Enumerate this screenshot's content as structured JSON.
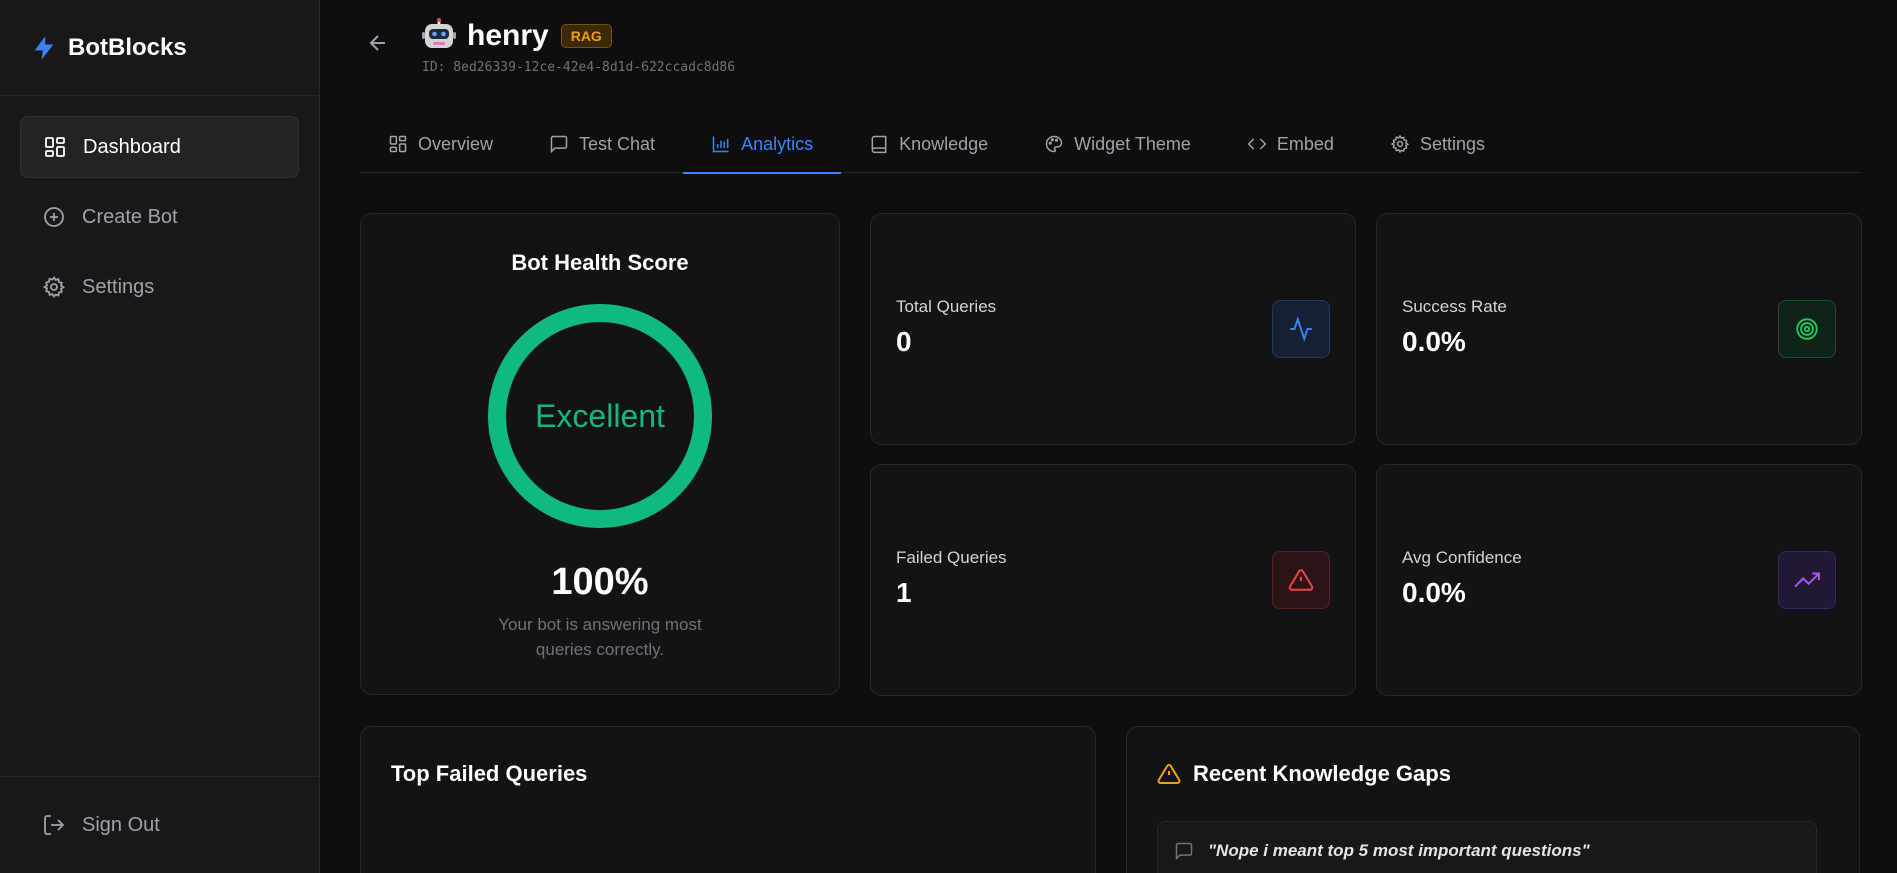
{
  "app": {
    "name": "BotBlocks",
    "accent": "#3b82f6"
  },
  "sidebar": {
    "items": [
      {
        "label": "Dashboard",
        "icon": "dashboard-icon",
        "active": true
      },
      {
        "label": "Create Bot",
        "icon": "plus-circle-icon"
      },
      {
        "label": "Settings",
        "icon": "gear-icon"
      }
    ],
    "sign_out": "Sign Out"
  },
  "bot": {
    "name": "henry",
    "badge": "RAG",
    "id_text": "ID: 8ed26339-12ce-42e4-8d1d-622ccadc8d86"
  },
  "tabs": [
    {
      "label": "Overview",
      "icon": "grid-icon"
    },
    {
      "label": "Test Chat",
      "icon": "chat-icon"
    },
    {
      "label": "Analytics",
      "icon": "bar-chart-icon",
      "active": true
    },
    {
      "label": "Knowledge",
      "icon": "book-icon"
    },
    {
      "label": "Widget Theme",
      "icon": "palette-icon"
    },
    {
      "label": "Embed",
      "icon": "code-icon"
    },
    {
      "label": "Settings",
      "icon": "gear-icon"
    }
  ],
  "health": {
    "title": "Bot Health Score",
    "status": "Excellent",
    "score": "100%",
    "score_fraction": 1.0,
    "description": "Your bot is answering most queries correctly.",
    "color": "#10b981"
  },
  "stats": [
    {
      "label": "Total Queries",
      "value": "0",
      "icon": "activity-icon",
      "color": "#3b82f6"
    },
    {
      "label": "Success Rate",
      "value": "0.0%",
      "icon": "target-icon",
      "color": "#22c55e"
    },
    {
      "label": "Failed Queries",
      "value": "1",
      "icon": "warning-icon",
      "color": "#ef4444"
    },
    {
      "label": "Avg Confidence",
      "value": "0.0%",
      "icon": "trending-up-icon",
      "color": "#a855f7"
    }
  ],
  "top_failed": {
    "title": "Top Failed Queries"
  },
  "knowledge_gaps": {
    "title": "Recent Knowledge Gaps",
    "items": [
      "\"Nope i meant top 5 most important questions\""
    ]
  }
}
